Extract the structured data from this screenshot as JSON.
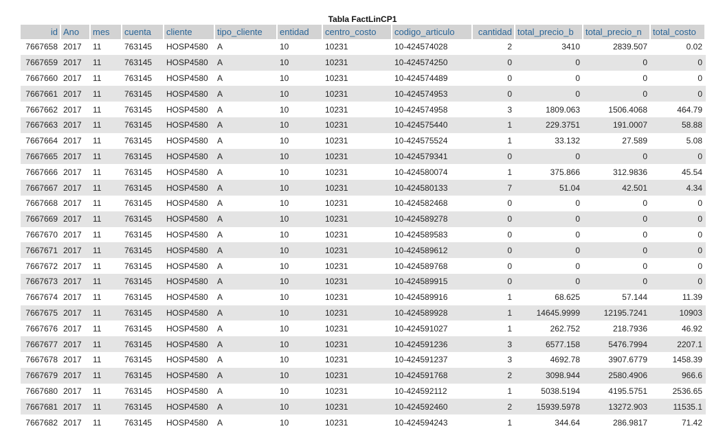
{
  "caption": "Tabla FactLinCP1",
  "table": {
    "headers": [
      "id",
      "Ano",
      "mes",
      "cuenta",
      "cliente",
      "tipo_cliente",
      "entidad",
      "centro_costo",
      "codigo_articulo",
      "cantidad",
      "total_precio_b",
      "total_precio_n",
      "total_costo"
    ],
    "rows": [
      [
        "7667658",
        "2017",
        "11",
        "763145",
        "HOSP4580",
        "A",
        "10",
        "10231",
        "10-424574028",
        "2",
        "3410",
        "2839.507",
        "0.02"
      ],
      [
        "7667659",
        "2017",
        "11",
        "763145",
        "HOSP4580",
        "A",
        "10",
        "10231",
        "10-424574250",
        "0",
        "0",
        "0",
        "0"
      ],
      [
        "7667660",
        "2017",
        "11",
        "763145",
        "HOSP4580",
        "A",
        "10",
        "10231",
        "10-424574489",
        "0",
        "0",
        "0",
        "0"
      ],
      [
        "7667661",
        "2017",
        "11",
        "763145",
        "HOSP4580",
        "A",
        "10",
        "10231",
        "10-424574953",
        "0",
        "0",
        "0",
        "0"
      ],
      [
        "7667662",
        "2017",
        "11",
        "763145",
        "HOSP4580",
        "A",
        "10",
        "10231",
        "10-424574958",
        "3",
        "1809.063",
        "1506.4068",
        "464.79"
      ],
      [
        "7667663",
        "2017",
        "11",
        "763145",
        "HOSP4580",
        "A",
        "10",
        "10231",
        "10-424575440",
        "1",
        "229.3751",
        "191.0007",
        "58.88"
      ],
      [
        "7667664",
        "2017",
        "11",
        "763145",
        "HOSP4580",
        "A",
        "10",
        "10231",
        "10-424575524",
        "1",
        "33.132",
        "27.589",
        "5.08"
      ],
      [
        "7667665",
        "2017",
        "11",
        "763145",
        "HOSP4580",
        "A",
        "10",
        "10231",
        "10-424579341",
        "0",
        "0",
        "0",
        "0"
      ],
      [
        "7667666",
        "2017",
        "11",
        "763145",
        "HOSP4580",
        "A",
        "10",
        "10231",
        "10-424580074",
        "1",
        "375.866",
        "312.9836",
        "45.54"
      ],
      [
        "7667667",
        "2017",
        "11",
        "763145",
        "HOSP4580",
        "A",
        "10",
        "10231",
        "10-424580133",
        "7",
        "51.04",
        "42.501",
        "4.34"
      ],
      [
        "7667668",
        "2017",
        "11",
        "763145",
        "HOSP4580",
        "A",
        "10",
        "10231",
        "10-424582468",
        "0",
        "0",
        "0",
        "0"
      ],
      [
        "7667669",
        "2017",
        "11",
        "763145",
        "HOSP4580",
        "A",
        "10",
        "10231",
        "10-424589278",
        "0",
        "0",
        "0",
        "0"
      ],
      [
        "7667670",
        "2017",
        "11",
        "763145",
        "HOSP4580",
        "A",
        "10",
        "10231",
        "10-424589583",
        "0",
        "0",
        "0",
        "0"
      ],
      [
        "7667671",
        "2017",
        "11",
        "763145",
        "HOSP4580",
        "A",
        "10",
        "10231",
        "10-424589612",
        "0",
        "0",
        "0",
        "0"
      ],
      [
        "7667672",
        "2017",
        "11",
        "763145",
        "HOSP4580",
        "A",
        "10",
        "10231",
        "10-424589768",
        "0",
        "0",
        "0",
        "0"
      ],
      [
        "7667673",
        "2017",
        "11",
        "763145",
        "HOSP4580",
        "A",
        "10",
        "10231",
        "10-424589915",
        "0",
        "0",
        "0",
        "0"
      ],
      [
        "7667674",
        "2017",
        "11",
        "763145",
        "HOSP4580",
        "A",
        "10",
        "10231",
        "10-424589916",
        "1",
        "68.625",
        "57.144",
        "11.39"
      ],
      [
        "7667675",
        "2017",
        "11",
        "763145",
        "HOSP4580",
        "A",
        "10",
        "10231",
        "10-424589928",
        "1",
        "14645.9999",
        "12195.7241",
        "10903"
      ],
      [
        "7667676",
        "2017",
        "11",
        "763145",
        "HOSP4580",
        "A",
        "10",
        "10231",
        "10-424591027",
        "1",
        "262.752",
        "218.7936",
        "46.92"
      ],
      [
        "7667677",
        "2017",
        "11",
        "763145",
        "HOSP4580",
        "A",
        "10",
        "10231",
        "10-424591236",
        "3",
        "6577.158",
        "5476.7994",
        "2207.1"
      ],
      [
        "7667678",
        "2017",
        "11",
        "763145",
        "HOSP4580",
        "A",
        "10",
        "10231",
        "10-424591237",
        "3",
        "4692.78",
        "3907.6779",
        "1458.39"
      ],
      [
        "7667679",
        "2017",
        "11",
        "763145",
        "HOSP4580",
        "A",
        "10",
        "10231",
        "10-424591768",
        "2",
        "3098.944",
        "2580.4906",
        "966.6"
      ],
      [
        "7667680",
        "2017",
        "11",
        "763145",
        "HOSP4580",
        "A",
        "10",
        "10231",
        "10-424592112",
        "1",
        "5038.5194",
        "4195.5751",
        "2536.65"
      ],
      [
        "7667681",
        "2017",
        "11",
        "763145",
        "HOSP4580",
        "A",
        "10",
        "10231",
        "10-424592460",
        "2",
        "15939.5978",
        "13272.903",
        "11535.1"
      ],
      [
        "7667682",
        "2017",
        "11",
        "763145",
        "HOSP4580",
        "A",
        "10",
        "10231",
        "10-424594243",
        "1",
        "344.64",
        "286.9817",
        "71.42"
      ]
    ]
  }
}
